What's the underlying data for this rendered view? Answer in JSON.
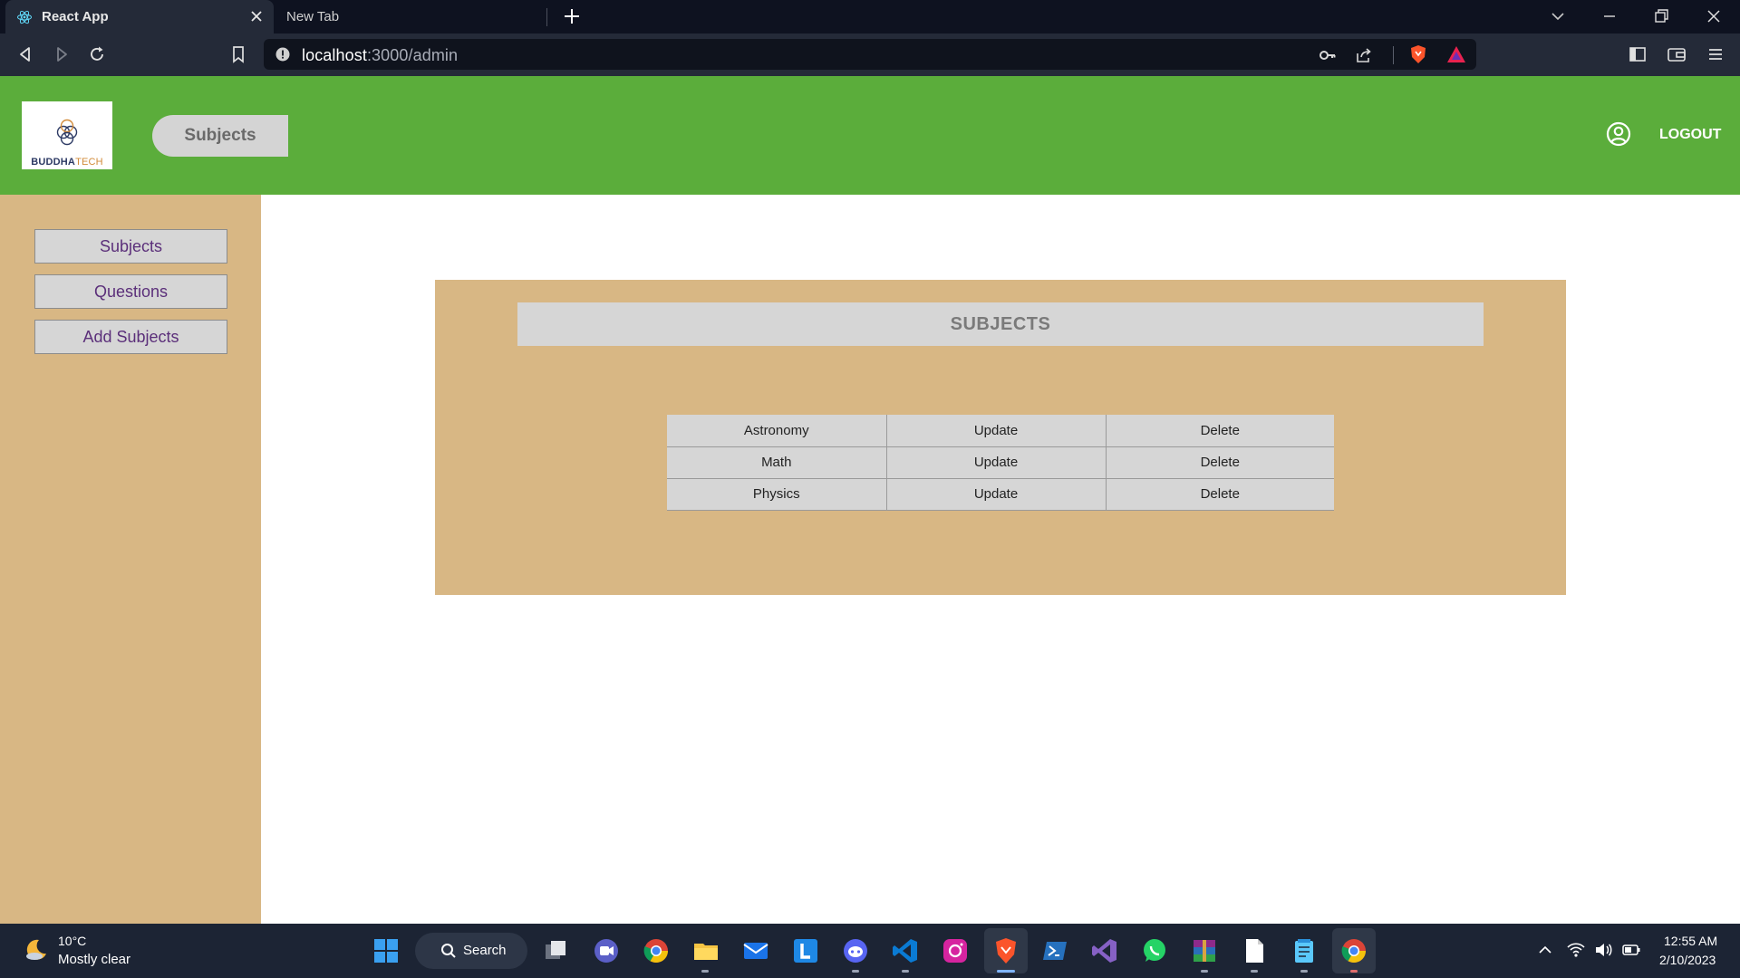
{
  "browser": {
    "active_tab": "React App",
    "inactive_tab": "New Tab",
    "url_host": "localhost",
    "url_path": ":3000/admin"
  },
  "header": {
    "logo_text_main": "BUDDHA",
    "logo_text_accent": "TECH",
    "page_pill": "Subjects",
    "logout_label": "LOGOUT",
    "accent_color": "#5bad3b"
  },
  "sidebar": {
    "items": [
      {
        "label": "Subjects"
      },
      {
        "label": "Questions"
      },
      {
        "label": "Add Subjects"
      }
    ]
  },
  "main": {
    "title": "SUBJECTS",
    "rows": [
      {
        "name": "Astronomy",
        "update": "Update",
        "delete": "Delete"
      },
      {
        "name": "Math",
        "update": "Update",
        "delete": "Delete"
      },
      {
        "name": "Physics",
        "update": "Update",
        "delete": "Delete"
      }
    ]
  },
  "taskbar": {
    "weather_temp": "10°C",
    "weather_desc": "Mostly clear",
    "search_label": "Search",
    "time": "12:55 AM",
    "date": "2/10/2023",
    "apps": [
      "windows-start",
      "search",
      "task-view",
      "teams",
      "chrome",
      "file-explorer",
      "mail",
      "l-app",
      "discord",
      "vscode",
      "instagram",
      "brave",
      "powershell",
      "visual-studio",
      "whatsapp",
      "winrar",
      "file",
      "notepad",
      "chrome-active"
    ]
  }
}
